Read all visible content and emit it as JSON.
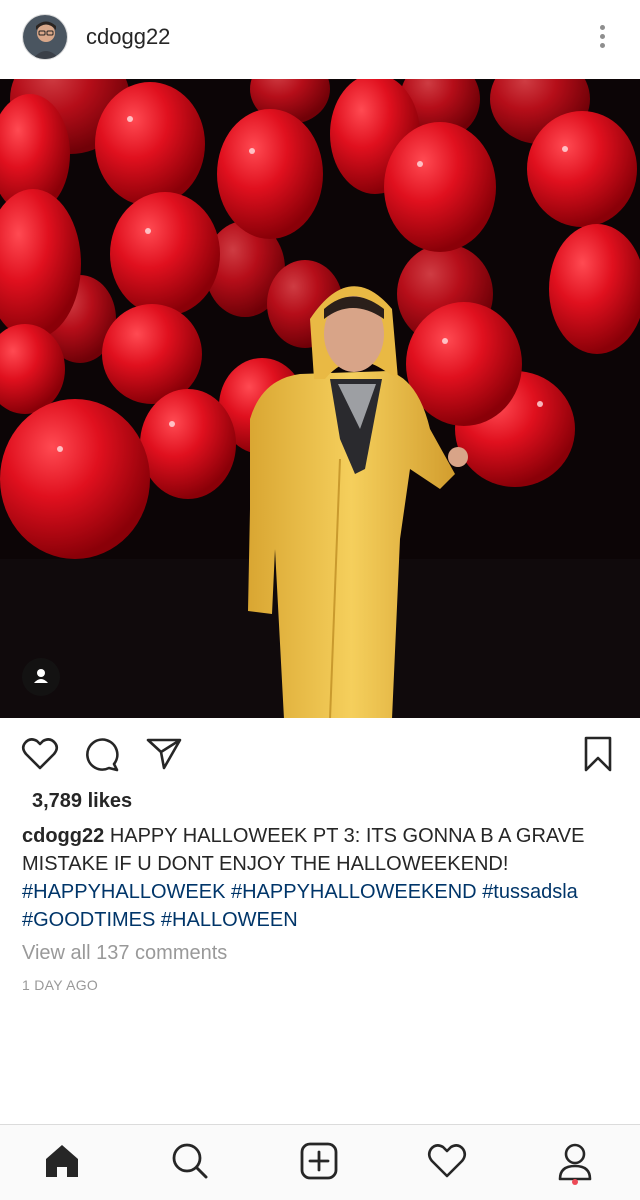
{
  "post": {
    "username": "cdogg22",
    "likes": "3,789 likes",
    "caption_user": "cdogg22",
    "caption_text": "HAPPY HALLOWEEK PT 3: ITS GONNA B A GRAVE MISTAKE IF U DONT ENJOY THE HALLOWEEKEND!",
    "hashtags": [
      "#HAPPYHALLOWEEK",
      "#HAPPYHALLOWEEKEND",
      "#tussadsla",
      "#GOODTIMES",
      "#HALLOWEEN"
    ],
    "view_comments": "View all 137 comments",
    "timestamp": "1 DAY AGO"
  },
  "icons": {
    "header": [
      "avatar",
      "more-vertical-icon"
    ],
    "actions": [
      "heart-icon",
      "comment-icon",
      "share-icon",
      "bookmark-icon"
    ],
    "photo": [
      "user-tag-icon"
    ],
    "nav": [
      "home-icon",
      "search-icon",
      "add-post-icon",
      "activity-heart-icon",
      "profile-icon"
    ]
  },
  "colors": {
    "hashtag": "#003569",
    "text": "#262626",
    "muted": "#999999",
    "notification_dot": "#ed4956",
    "balloon_red": "#e0101e",
    "raincoat_yellow": "#f0c24a"
  }
}
